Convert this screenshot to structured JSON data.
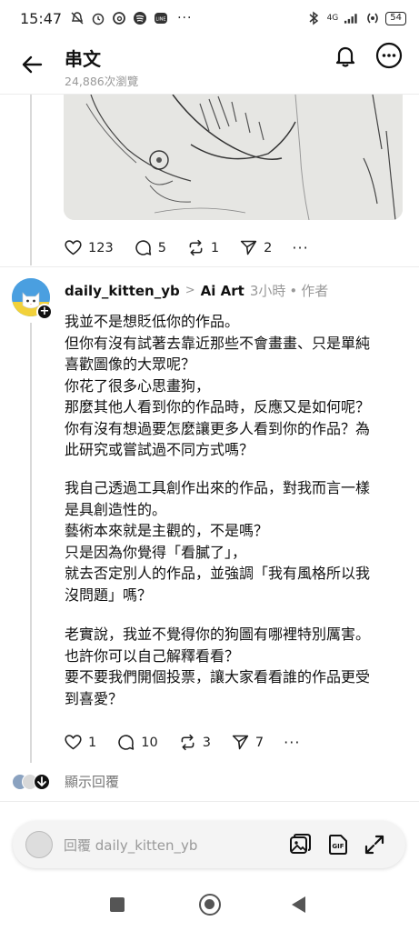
{
  "status_bar": {
    "time": "15:47",
    "network": "4G",
    "battery": "54",
    "more": "···"
  },
  "header": {
    "title": "串文",
    "views": "24,886次瀏覽"
  },
  "parent_post": {
    "actions": {
      "likes": "123",
      "comments": "5",
      "reposts": "1",
      "shares": "2",
      "more": "···"
    }
  },
  "reply": {
    "username": "daily_kitten_yb",
    "chevron": ">",
    "reply_to": "Ai Art",
    "time": "3小時",
    "separator": "•",
    "role": "作者",
    "paragraphs": [
      [
        "我並不是想貶低你的作品。",
        "但你有沒有試著去靠近那些不會畫畫、只是單純",
        "喜歡圖像的大眾呢？",
        "你花了很多心思畫狗，",
        "那麼其他人看到你的作品時，反應又是如何呢？",
        "你有沒有想過要怎麼讓更多人看到你的作品？為",
        "此研究或嘗試過不同方式嗎？"
      ],
      [
        "我自己透過工具創作出來的作品，對我而言一樣",
        "是具創造性的。",
        "藝術本來就是主觀的，不是嗎？",
        "只是因為你覺得「看膩了」，",
        "就去否定別人的作品，並強調「我有風格所以我",
        "沒問題」嗎？"
      ],
      [
        "老實說，我並不覺得你的狗圖有哪裡特別厲害。",
        "也許你可以自己解釋看看？",
        "要不要我們開個投票，讓大家看看誰的作品更受",
        "到喜愛？"
      ]
    ],
    "actions": {
      "likes": "1",
      "comments": "10",
      "reposts": "3",
      "shares": "7",
      "more": "···"
    },
    "show_replies": "顯示回覆"
  },
  "composer": {
    "placeholder": "回覆 daily_kitten_yb"
  },
  "colors": {
    "muted": "#999999",
    "avatar_blue": "#4a9fe0",
    "avatar_yellow": "#f2d13a",
    "divider": "#ececec"
  }
}
